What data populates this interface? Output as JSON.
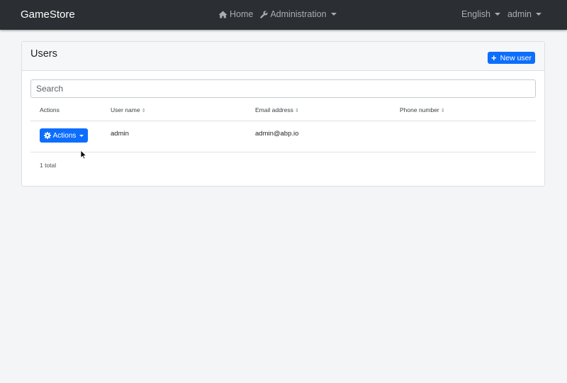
{
  "navbar": {
    "brand": "GameStore",
    "links": [
      {
        "label": "Home",
        "icon": "home-icon"
      },
      {
        "label": "Administration",
        "icon": "wrench-icon"
      }
    ],
    "language": "English",
    "user": "admin"
  },
  "users_card": {
    "title": "Users",
    "new_user_label": "New user",
    "search_placeholder": "Search",
    "columns": {
      "actions": "Actions",
      "user_name": "User name",
      "email": "Email address",
      "phone": "Phone number"
    },
    "rows": [
      {
        "actions_label": "Actions",
        "user_name": "admin",
        "email": "admin@abp.io",
        "phone": ""
      }
    ],
    "total_text": "1 total"
  },
  "colors": {
    "navbar_bg": "#2b2f33",
    "primary": "#0d6efd",
    "page_bg": "#f4f5f7"
  }
}
